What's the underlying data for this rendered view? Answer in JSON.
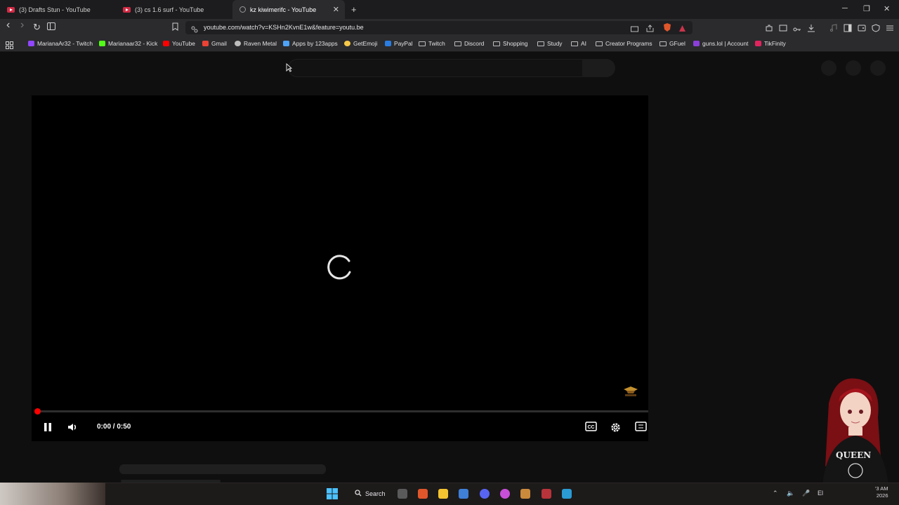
{
  "tabs": [
    {
      "title": "(3) Drafts Stun - YouTube",
      "active": false
    },
    {
      "title": "(3) cs 1.6 surf - YouTube",
      "active": false
    },
    {
      "title": "kz kiwimerifc - YouTube",
      "active": true
    }
  ],
  "new_tab_label": "+",
  "window_controls": {
    "minimize": "─",
    "restore": "❐",
    "close": "✕"
  },
  "toolbar": {
    "back": "‹",
    "forward": "›",
    "reload": "↻",
    "url": "youtube.com/watch?v=KSHn2KvnE1w&feature=youtu.be"
  },
  "bookmarks": [
    {
      "label": "MarianaAr32 - Twitch",
      "icon": "twitch-icon",
      "color": "#9146ff"
    },
    {
      "label": "Marianaar32 - Kick",
      "icon": "kick-icon",
      "color": "#53fc18"
    },
    {
      "label": "YouTube",
      "icon": "youtube-icon",
      "color": "#ff0000"
    },
    {
      "label": "Gmail",
      "icon": "gmail-icon",
      "color": "#ea4335"
    },
    {
      "label": "Raven Metal",
      "icon": "globe-icon",
      "color": "#bdbdbd"
    },
    {
      "label": "Apps by 123apps",
      "icon": "apps-icon",
      "color": "#4fa3f7"
    },
    {
      "label": "GetEmoji",
      "icon": "emoji-icon",
      "color": "#f7c948"
    },
    {
      "label": "PayPal",
      "icon": "paypal-icon",
      "color": "#2a7de1"
    },
    {
      "label": "Twitch",
      "icon": "folder-icon",
      "color": "folder"
    },
    {
      "label": "Discord",
      "icon": "folder-icon",
      "color": "folder"
    },
    {
      "label": "Shopping",
      "icon": "folder-icon",
      "color": "folder"
    },
    {
      "label": "Study",
      "icon": "folder-icon",
      "color": "folder"
    },
    {
      "label": "AI",
      "icon": "folder-icon",
      "color": "folder"
    },
    {
      "label": "Creator Programs",
      "icon": "folder-icon",
      "color": "folder"
    },
    {
      "label": "GFuel",
      "icon": "folder-icon",
      "color": "folder"
    },
    {
      "label": "guns.lol | Account",
      "icon": "guns-icon",
      "color": "#8b3fd9"
    },
    {
      "label": "TikFinity",
      "icon": "tikfinity-icon",
      "color": "#e0245e"
    }
  ],
  "player": {
    "time": "0:00 / 0:50",
    "progress": 0.0,
    "state": "loading"
  },
  "taskbar": {
    "search_label": "Search",
    "clock_line1": "'3 AM",
    "clock_line2": "2026",
    "lang": "El"
  },
  "colors": {
    "accent": "#ff0000",
    "page_bg": "#0f0f0f",
    "chrome_bg": "#2b2b2e"
  }
}
